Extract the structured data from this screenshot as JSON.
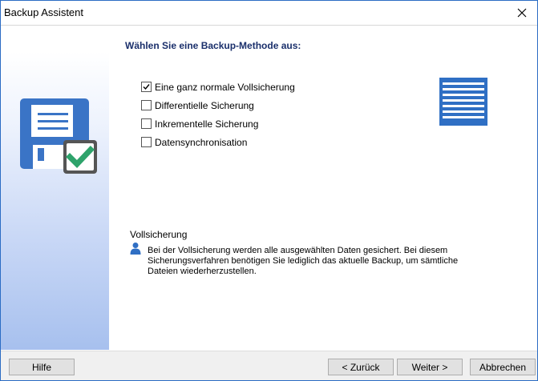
{
  "window": {
    "title": "Backup Assistent",
    "close_icon": "close-icon"
  },
  "content": {
    "heading": "Wählen Sie eine Backup-Methode aus:",
    "options": [
      {
        "label": "Eine ganz normale Vollsicherung",
        "checked": true
      },
      {
        "label": "Differentielle  Sicherung",
        "checked": false
      },
      {
        "label": "Inkrementelle Sicherung",
        "checked": false
      },
      {
        "label": "Datensynchronisation",
        "checked": false
      }
    ],
    "description": {
      "title": "Vollsicherung",
      "text": "Bei der Vollsicherung werden alle ausgewählten Daten gesichert. Bei diesem Sicherungsverfahren benötigen Sie lediglich das aktuelle Backup, um sämtliche Dateien wiederherzustellen."
    }
  },
  "buttons": {
    "help": "Hilfe",
    "back": "< Zurück",
    "next": "Weiter >",
    "cancel": "Abbrechen"
  },
  "colors": {
    "accent": "#2f6fc4",
    "heading": "#1a2f6b",
    "check_green": "#2ea36b"
  }
}
